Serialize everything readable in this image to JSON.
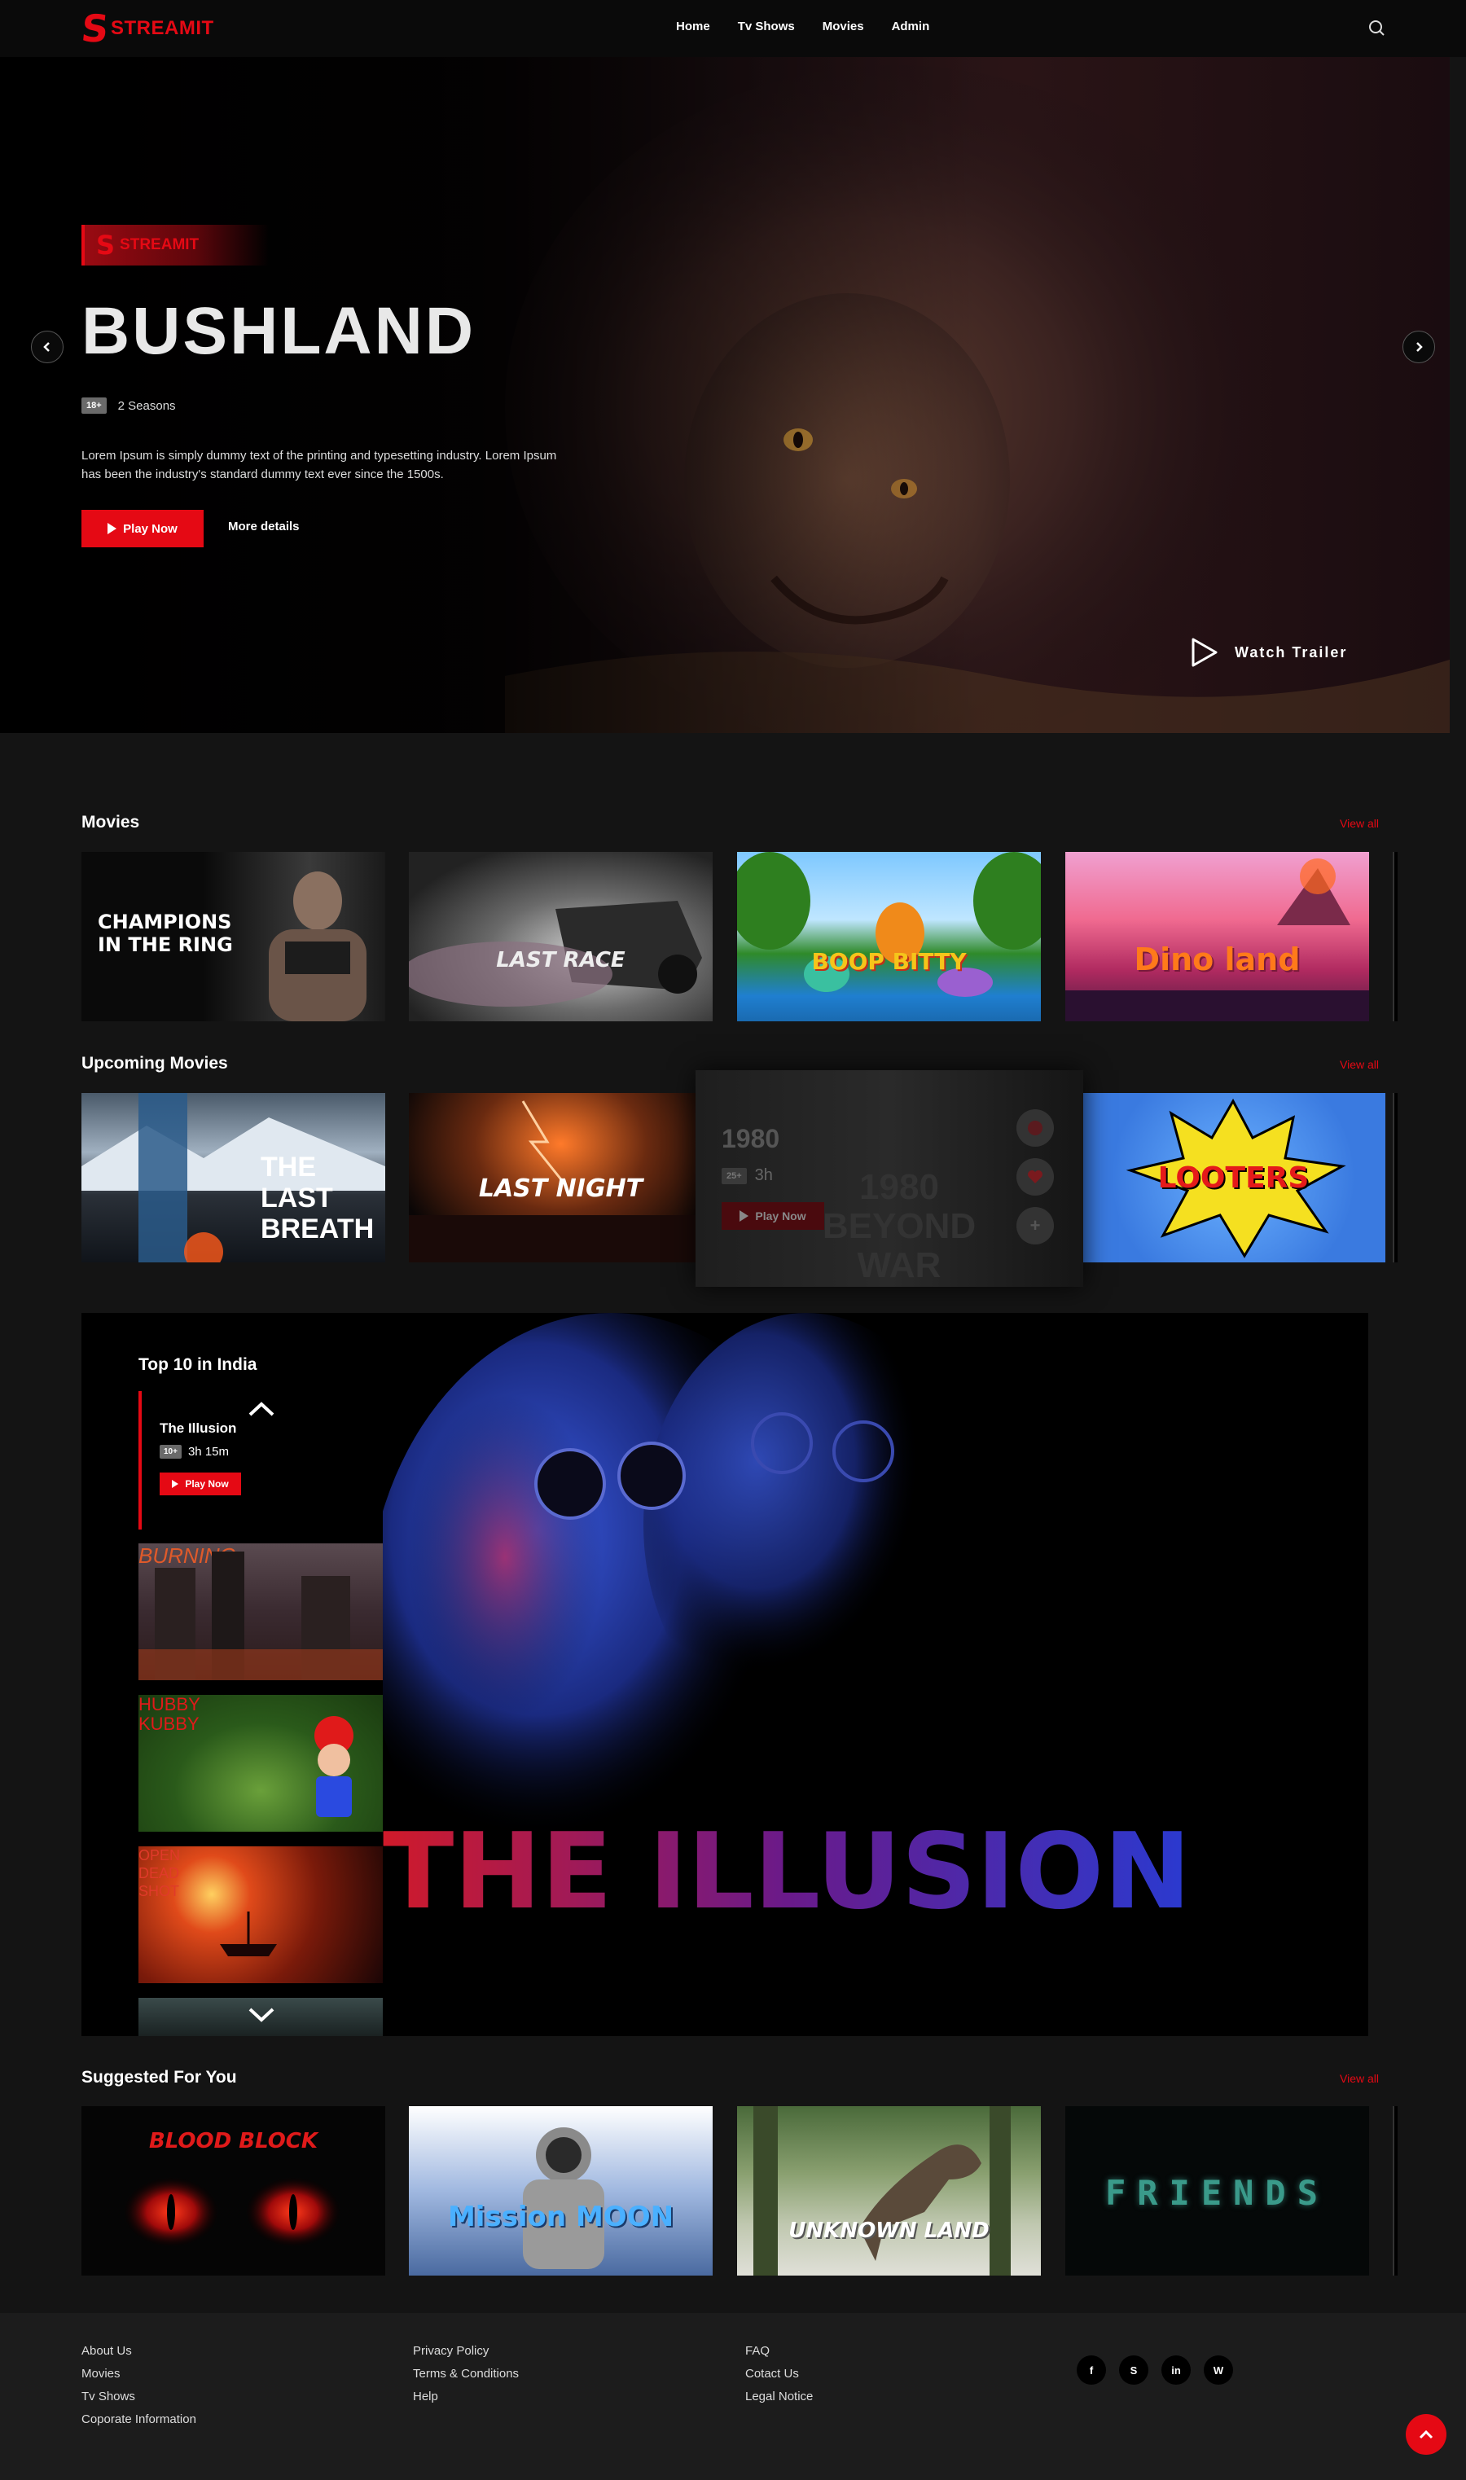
{
  "brand": {
    "name": "STREAMIT"
  },
  "nav": [
    "Home",
    "Tv Shows",
    "Movies",
    "Admin"
  ],
  "hero": {
    "badge": "STREAMIT",
    "title": "BUSHLAND",
    "rating": "18+",
    "seasons": "2 Seasons",
    "description": "Lorem Ipsum is simply dummy text of the printing and typesetting industry. Lorem Ipsum has been the industry's standard dummy text ever since the 1500s.",
    "play_label": "Play Now",
    "more_label": "More details",
    "trailer_label": "Watch Trailer"
  },
  "movies": {
    "title": "Movies",
    "view_all": "View all",
    "cards": [
      "CHAMPIONS IN THE RING",
      "LAST RACE",
      "BOOP BITTY",
      "Dino land"
    ]
  },
  "upcoming": {
    "title": "Upcoming Movies",
    "view_all": "View all",
    "cards": [
      "THE LAST BREATH",
      "LAST NIGHT",
      "1980 BEYOND WAR",
      "LOOTERS"
    ],
    "hover": {
      "title": "1980",
      "rating": "25+",
      "duration": "3h",
      "play_label": "Play Now"
    }
  },
  "top10": {
    "title": "Top 10 in India",
    "featured": {
      "title": "The Illusion",
      "rating": "10+",
      "duration": "3h 15m",
      "play_label": "Play Now"
    },
    "thumbs": [
      "BURNING",
      "HUBBY KUBBY",
      "OPEN DEAD SHOT"
    ],
    "banner_title": "THE ILLUSION"
  },
  "suggested": {
    "title": "Suggested For You",
    "view_all": "View all",
    "cards": [
      "BLOOD BLOCK",
      "Mission MOON",
      "UNKNOWN LAND",
      "FRIENDS"
    ]
  },
  "footer": {
    "col1": [
      "About Us",
      "Movies",
      "Tv Shows",
      "Coporate Information"
    ],
    "col2": [
      "Privacy Policy",
      "Terms & Conditions",
      "Help"
    ],
    "col3": [
      "FAQ",
      "Cotact Us",
      "Legal Notice"
    ],
    "social": [
      "f",
      "S",
      "in",
      "W"
    ]
  },
  "colors": {
    "accent": "#e50914",
    "background": "#141414",
    "header": "#0a0a0a",
    "footer": "#1c1c1c"
  }
}
